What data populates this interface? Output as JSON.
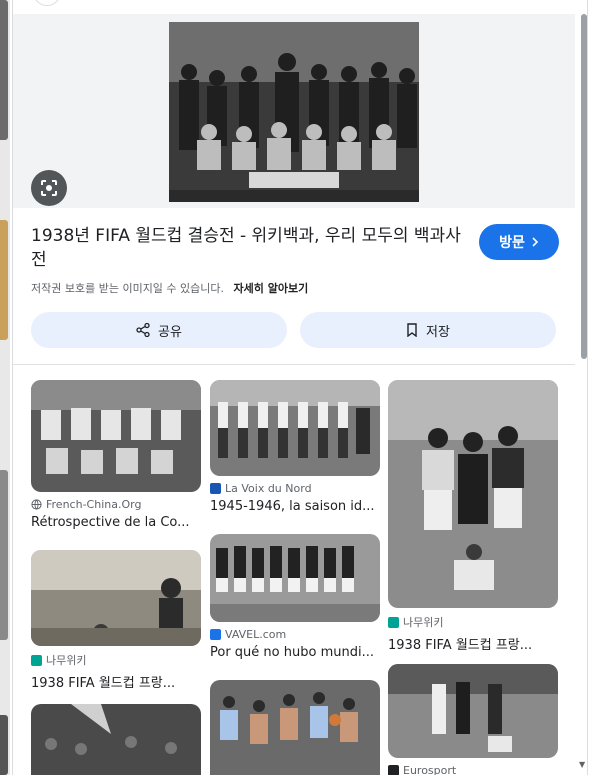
{
  "detail": {
    "title": "1938년 FIFA 월드컵 결승전 - 위키백과, 우리 모두의 백과사전",
    "visit_label": "방문",
    "copyright_text": "저작권 보호를 받는 이미지일 수 있습니다.",
    "learn_more": "자세히 알아보기",
    "share_label": "공유",
    "save_label": "저장"
  },
  "related": [
    {
      "source": "French-China.Org",
      "title": "Rétrospective de la Co...",
      "favicon": "globe-icon"
    },
    {
      "source": "나무위키",
      "title": "1938 FIFA 월드컵 프랑...",
      "favicon": "namuwiki-icon"
    },
    {
      "source": "La Voix du Nord",
      "title": "1945-1946, la saison id...",
      "favicon": "lavoix-icon"
    },
    {
      "source": "VAVEL.com",
      "title": "Por qué no hubo mundi...",
      "favicon": "vavel-icon"
    },
    {
      "source": "나무위키",
      "title": "1938 FIFA 월드컵 프랑...",
      "favicon": "namuwiki-icon"
    },
    {
      "source": "Eurosport",
      "title": "",
      "favicon": "eurosport-icon"
    }
  ],
  "colors": {
    "accent": "#1a73e8",
    "button_bg": "#e8f0fe",
    "namuwiki": "#00a495"
  }
}
